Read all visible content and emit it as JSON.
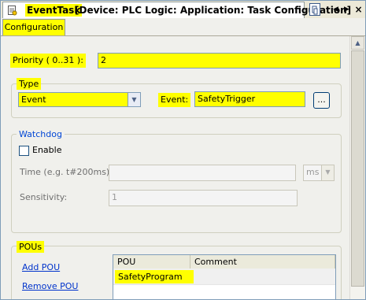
{
  "window": {
    "title_name": "EventTask",
    "title_path": "[Device: PLC Logic: Application: Task Configuration]"
  },
  "tabs": {
    "configuration": "Configuration"
  },
  "priority": {
    "label": "Priority ( 0..31 ):",
    "value": "2"
  },
  "type_group": {
    "title": "Type",
    "type_value": "Event",
    "event_label": "Event:",
    "event_value": "SafetyTrigger",
    "browse_label": "..."
  },
  "watchdog": {
    "title": "Watchdog",
    "enable_label": "Enable",
    "enable_checked": false,
    "time_label": "Time (e.g. t#200ms):",
    "time_value": "",
    "time_unit": "ms",
    "sensitivity_label": "Sensitivity:",
    "sensitivity_value": "1"
  },
  "pous": {
    "title": "POUs",
    "add_label": "Add POU",
    "remove_label": "Remove POU",
    "columns": [
      "POU",
      "Comment"
    ],
    "rows": [
      {
        "pou": "SafetyProgram",
        "comment": ""
      }
    ]
  },
  "colors": {
    "highlight": "#ffff00",
    "group_title": "#0046d5",
    "link": "#0033cc"
  },
  "icons": {
    "doc": "task-doc-icon",
    "nav_left": "left-arrow-icon",
    "nav_right": "right-arrow-icon",
    "close": "close-icon"
  }
}
